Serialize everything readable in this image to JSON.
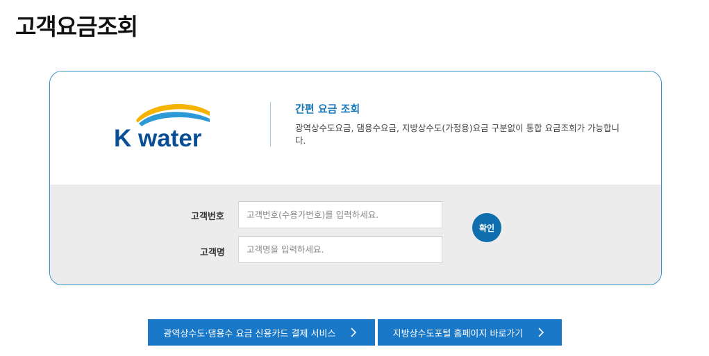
{
  "page": {
    "title": "고객요금조회"
  },
  "intro": {
    "logo_text": "K water",
    "title": "간편 요금 조회",
    "description": "광역상수도요금, 댐용수요금, 지방상수도(가정용)요금 구분없이 통합 요금조회가 가능합니다."
  },
  "form": {
    "customer_number_label": "고객번호",
    "customer_number_placeholder": "고객번호(수용가번호)를 입력하세요.",
    "customer_number_value": "",
    "customer_name_label": "고객명",
    "customer_name_placeholder": "고객명을 입력하세요.",
    "customer_name_value": "",
    "confirm_label": "확인"
  },
  "links": {
    "card_payment_label": "광역상수도·댐용수 요금 신용카드 결제 서비스",
    "local_portal_label": "지방상수도포털 홈페이지 바로가기"
  },
  "colors": {
    "accent": "#1878b8",
    "button": "#1a78c8",
    "confirm": "#0f6fae",
    "form_bg": "#ececec"
  },
  "icons": {
    "link_arrow": "chevron-right-icon"
  }
}
